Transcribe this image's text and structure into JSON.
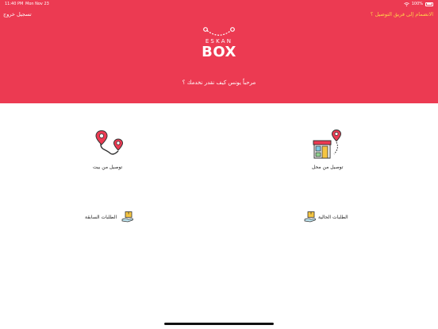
{
  "status_bar": {
    "time": "11:40 PM",
    "date": "Mon Nov 23",
    "battery": "100%"
  },
  "header": {
    "logout": "تسجيل خروج",
    "join_delivery": "الانضمام إلى فريق التوصيل ؟",
    "logo_top": "ESKAN",
    "logo_bottom": "BOX",
    "welcome": "مرحباً يونس كيف نقدر نخدمك ؟"
  },
  "menu": {
    "from_shop": "توصيل من محل",
    "from_home": "توصيل من بيت",
    "current_orders": "الطلبات الحالية",
    "previous_orders": "الطلبات السابقة"
  },
  "colors": {
    "brand": "#ec3a52",
    "join_link": "#ffd24a"
  }
}
